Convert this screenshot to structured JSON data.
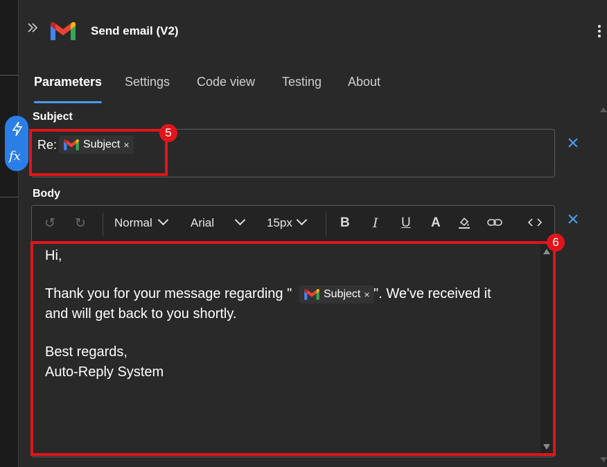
{
  "header": {
    "title": "Send email (V2)"
  },
  "tabs": [
    {
      "label": "Parameters",
      "active": true
    },
    {
      "label": "Settings",
      "active": false
    },
    {
      "label": "Code view",
      "active": false
    },
    {
      "label": "Testing",
      "active": false
    },
    {
      "label": "About",
      "active": false
    }
  ],
  "subject": {
    "label": "Subject",
    "prefix": "Re:",
    "token_label": "Subject",
    "token_remove": "×"
  },
  "body": {
    "label": "Body",
    "toolbar": {
      "block_format": "Normal",
      "font_family": "Arial",
      "font_size": "15px",
      "icons": [
        "undo-icon",
        "redo-icon",
        "bold-icon",
        "italic-icon",
        "underline-icon",
        "font-color-icon",
        "highlight-icon",
        "link-icon",
        "code-view-icon"
      ]
    },
    "lines": {
      "greeting": "Hi,",
      "line1_before": "Thank you for your message regarding \"",
      "line1_after": "\". We've received it",
      "line2": "and will get back to you shortly.",
      "signoff": "Best regards,",
      "signature": "Auto-Reply System"
    },
    "token_label": "Subject",
    "token_remove": "×"
  },
  "annotations": {
    "subject_badge": "5",
    "body_badge": "6"
  },
  "colors": {
    "accent": "#4a9bea",
    "highlight": "#e0151b",
    "panel": "#292929"
  }
}
